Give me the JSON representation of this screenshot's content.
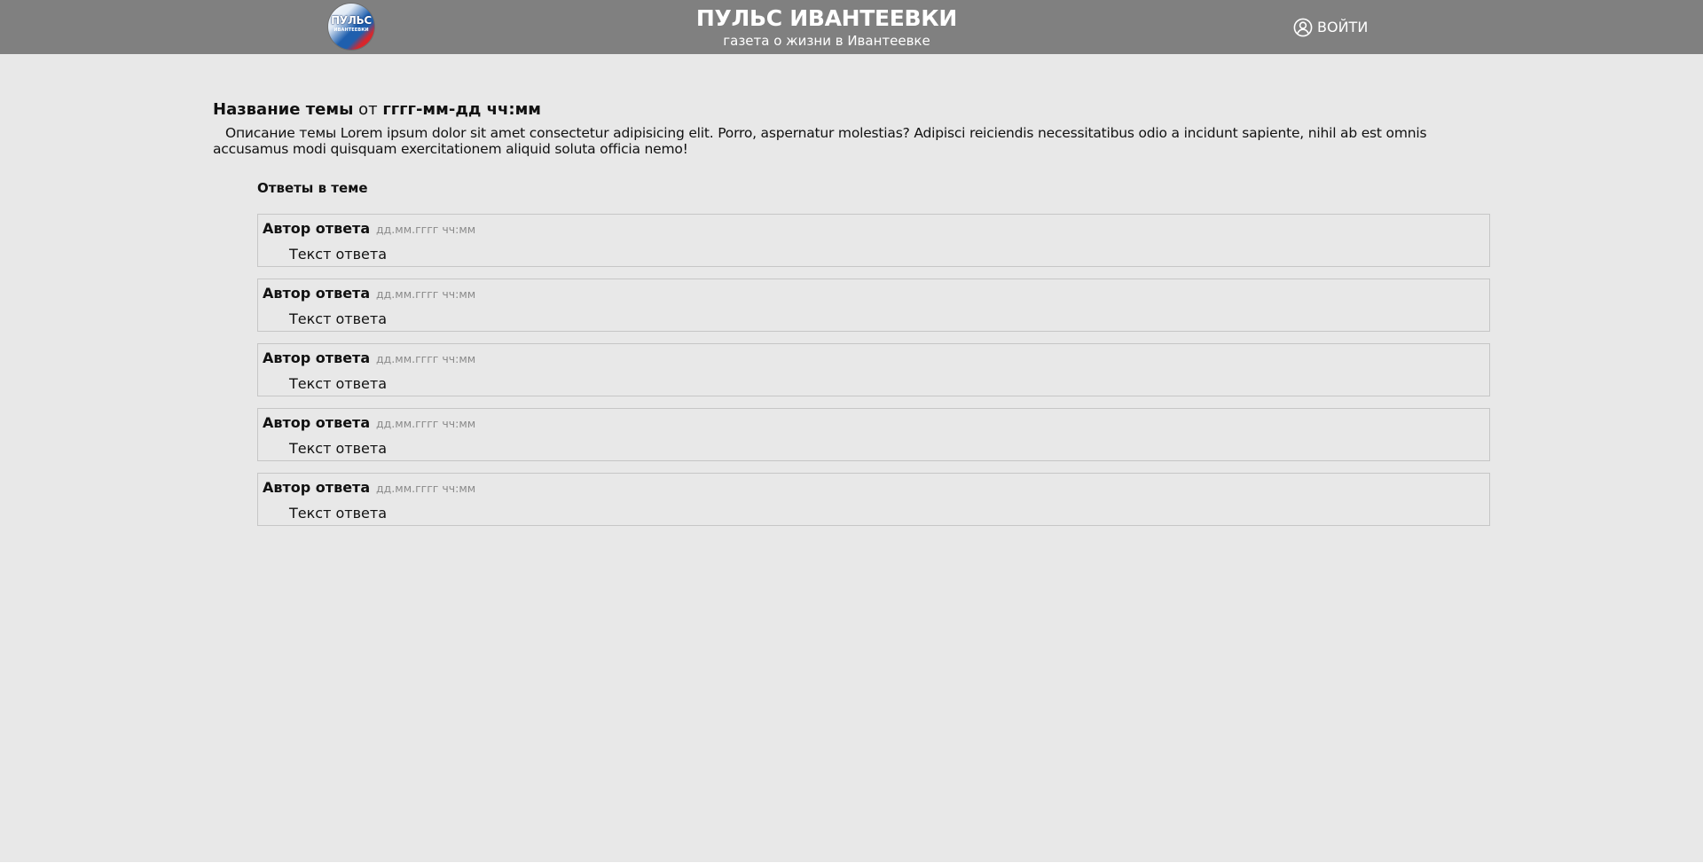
{
  "header": {
    "logo": {
      "text_main": "ПУЛЬС",
      "text_sub": "ИВАНТЕЕВКИ"
    },
    "title": "ПУЛЬС ИВАНТЕЕВКИ",
    "subtitle": "газета о жизни в Ивантеевке",
    "login_label": "ВОЙТИ",
    "login_icon": "user-circle-icon",
    "background_color": "#808080"
  },
  "topic": {
    "title": "Название темы",
    "by_word": "от",
    "datetime": "гггг-мм-дд чч:мм",
    "description": "Описание темы Lorem ipsum dolor sit amet consectetur adipisicing elit. Porro, aspernatur molestias? Adipisci reiciendis necessitatibus odio a incidunt sapiente, nihil ab est omnis accusamus modi quisquam exercitationem aliquid soluta officia nemo!"
  },
  "replies": {
    "heading": "Ответы в теме",
    "items": [
      {
        "author": "Автор ответа",
        "datetime": "дд.мм.гггг чч:мм",
        "text": "Текст ответа"
      },
      {
        "author": "Автор ответа",
        "datetime": "дд.мм.гггг чч:мм",
        "text": "Текст ответа"
      },
      {
        "author": "Автор ответа",
        "datetime": "дд.мм.гггг чч:мм",
        "text": "Текст ответа"
      },
      {
        "author": "Автор ответа",
        "datetime": "дд.мм.гггг чч:мм",
        "text": "Текст ответа"
      },
      {
        "author": "Автор ответа",
        "datetime": "дд.мм.гггг чч:мм",
        "text": "Текст ответа"
      }
    ]
  },
  "colors": {
    "page_background": "#e8e8e8",
    "reply_border": "#c6c6c6",
    "date_text": "#8a8a8a"
  }
}
